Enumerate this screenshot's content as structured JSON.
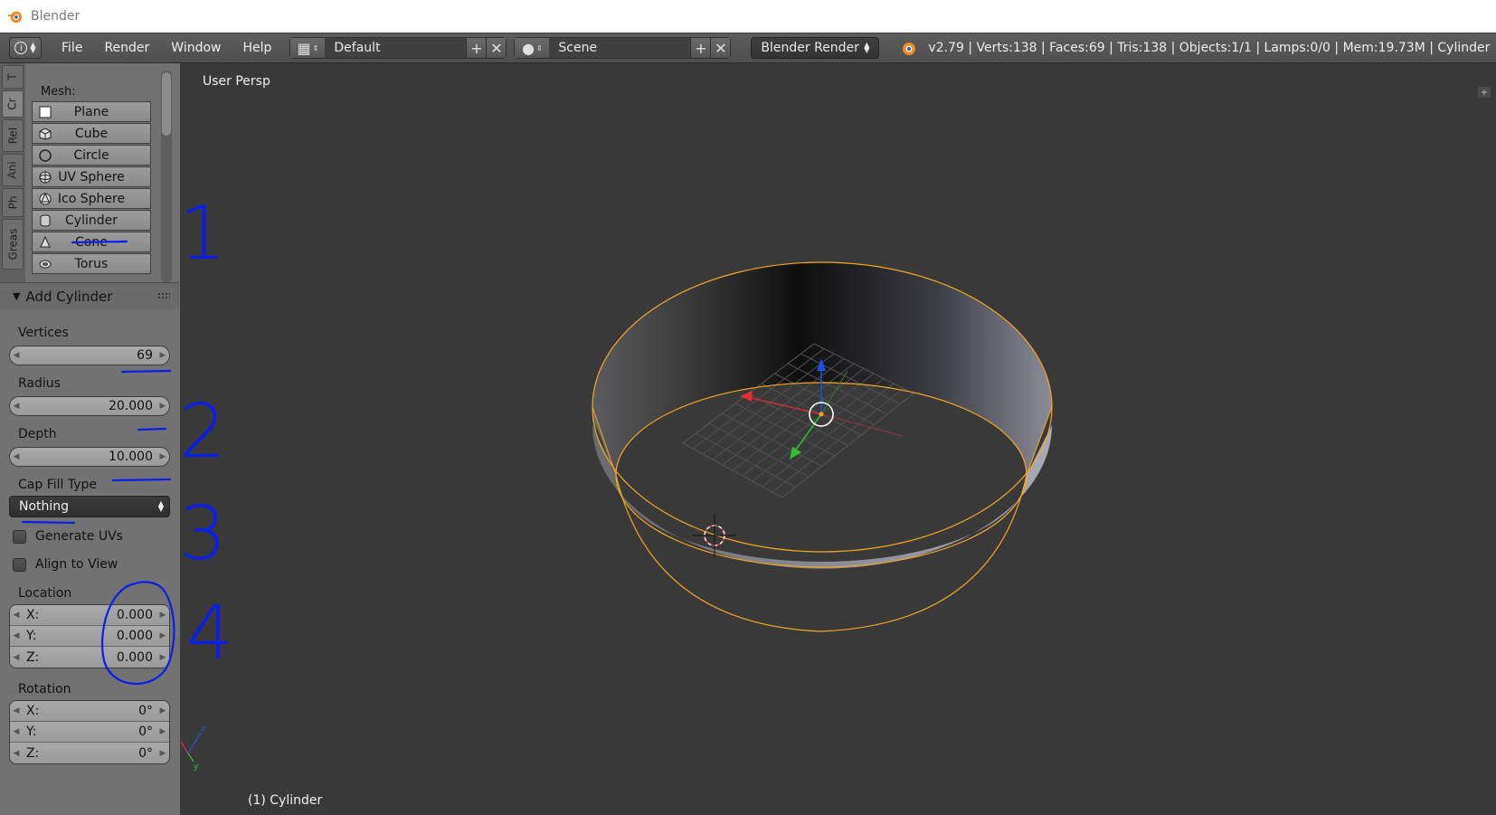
{
  "window": {
    "title": "Blender"
  },
  "header": {
    "menus": [
      "File",
      "Render",
      "Window",
      "Help"
    ],
    "layout": "Default",
    "scene": "Scene",
    "render_engine": "Blender Render",
    "stats": "v2.79 | Verts:138 | Faces:69 | Tris:138 | Objects:1/1 | Lamps:0/0 | Mem:19.73M | Cylinder"
  },
  "toolshelf": {
    "tabs": [
      "T",
      "Cr",
      "Rel",
      "Ani",
      "Ph",
      "Greas"
    ],
    "mesh_label": "Mesh:",
    "mesh_buttons": [
      "Plane",
      "Cube",
      "Circle",
      "UV Sphere",
      "Ico Sphere",
      "Cylinder",
      "Cone",
      "Torus"
    ]
  },
  "operator": {
    "title": "Add Cylinder",
    "vertices_label": "Vertices",
    "vertices": "69",
    "radius_label": "Radius",
    "radius": "20.000",
    "depth_label": "Depth",
    "depth": "10.000",
    "cap_fill_label": "Cap Fill Type",
    "cap_fill": "Nothing",
    "generate_uvs": "Generate UVs",
    "align_to_view": "Align to View",
    "location_label": "Location",
    "location": [
      {
        "axis": "X:",
        "value": "0.000"
      },
      {
        "axis": "Y:",
        "value": "0.000"
      },
      {
        "axis": "Z:",
        "value": "0.000"
      }
    ],
    "rotation_label": "Rotation",
    "rotation": [
      {
        "axis": "X:",
        "value": "0°"
      },
      {
        "axis": "Y:",
        "value": "0°"
      },
      {
        "axis": "Z:",
        "value": "0°"
      }
    ]
  },
  "viewport": {
    "view_label": "User Persp",
    "object_label": "(1) Cylinder"
  },
  "annotations": [
    "1",
    "2",
    "3",
    "4"
  ],
  "colors": {
    "selection_outline": "#f5a623",
    "annotation_ink": "#0a1ee8",
    "x_axis": "#e03030",
    "y_axis": "#30c030",
    "z_axis": "#2050e8"
  }
}
